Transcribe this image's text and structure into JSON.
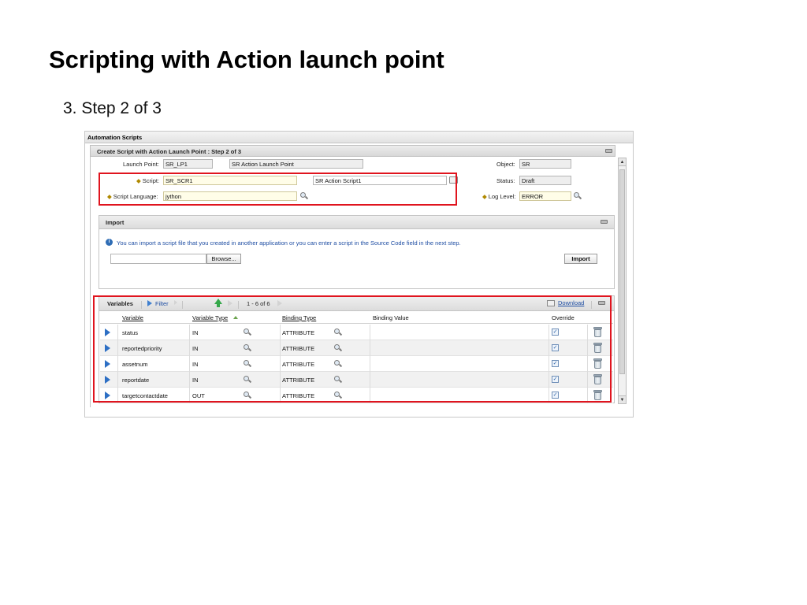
{
  "slide": {
    "title": "Scripting with Action launch point",
    "subtitle": "3. Step 2 of 3"
  },
  "app": {
    "header_title": "Automation Scripts",
    "dialog_title": "Create Script with Action Launch Point : Step 2 of 3"
  },
  "form": {
    "launch_point_label": "Launch Point:",
    "launch_point_value": "SR_LP1",
    "launch_point_desc": "SR Action Launch Point",
    "object_label": "Object:",
    "object_value": "SR",
    "script_label": "Script:",
    "script_value": "SR_SCR1",
    "script_desc": "SR Action Script1",
    "status_label": "Status:",
    "status_value": "Draft",
    "language_label": "Script Language:",
    "language_value": "jython",
    "log_level_label": "Log Level:",
    "log_level_value": "ERROR"
  },
  "import_section": {
    "title": "Import",
    "info_text": "You can import a script file that you created in another application or you can enter a script in the Source Code field in the next step.",
    "file_value": "",
    "browse_label": "Browse...",
    "import_label": "Import"
  },
  "variables": {
    "title": "Variables",
    "filter_label": "Filter",
    "pagination": "1 - 6 of 6",
    "download_label": "Download",
    "columns": {
      "variable": "Variable",
      "variable_type": "Variable Type",
      "binding_type": "Binding Type",
      "binding_value": "Binding Value",
      "override": "Override"
    },
    "rows": [
      {
        "variable": "status",
        "variable_type": "IN",
        "binding_type": "ATTRIBUTE",
        "binding_value": "",
        "override": true
      },
      {
        "variable": "reportedpriority",
        "variable_type": "IN",
        "binding_type": "ATTRIBUTE",
        "binding_value": "",
        "override": true
      },
      {
        "variable": "assetnum",
        "variable_type": "IN",
        "binding_type": "ATTRIBUTE",
        "binding_value": "",
        "override": true
      },
      {
        "variable": "reportdate",
        "variable_type": "IN",
        "binding_type": "ATTRIBUTE",
        "binding_value": "",
        "override": true
      },
      {
        "variable": "targetcontactdate",
        "variable_type": "OUT",
        "binding_type": "ATTRIBUTE",
        "binding_value": "",
        "override": true
      }
    ]
  },
  "colors": {
    "highlight_border": "#e0141e",
    "link": "#1f4ea3",
    "row_arrow": "#2d6fc4"
  }
}
